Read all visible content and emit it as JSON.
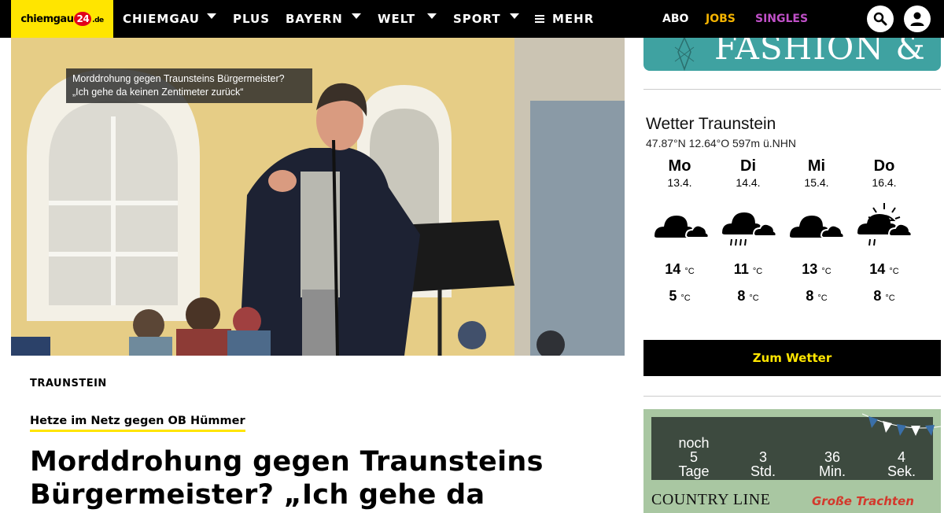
{
  "header": {
    "logo": {
      "prefix": "chiemgau",
      "number": "24",
      "suffix": ".de"
    },
    "nav": [
      {
        "label": "CHIEMGAU",
        "has_dropdown": true
      },
      {
        "label": "PLUS",
        "has_dropdown": false
      },
      {
        "label": "BAYERN",
        "has_dropdown": true
      },
      {
        "label": "WELT",
        "has_dropdown": true
      },
      {
        "label": "SPORT",
        "has_dropdown": true
      },
      {
        "label": "MEHR",
        "has_dropdown": false
      }
    ],
    "right_links": [
      {
        "label": "ABO",
        "color": "#ffffff"
      },
      {
        "label": "JOBS",
        "color": "#f5b400"
      },
      {
        "label": "SINGLES",
        "color": "#c050c8"
      }
    ],
    "search_icon": "search-icon",
    "account_icon": "user-icon"
  },
  "hero": {
    "caption_line1": "Morddrohung gegen Traunsteins Bürgermeister?",
    "caption_line2": "„Ich gehe da keinen Zentimeter zurück“"
  },
  "article": {
    "location": "TRAUNSTEIN",
    "topic": "Hetze im Netz gegen OB Hümmer",
    "headline": "Morddrohung gegen Traunsteins Bürgermeister? „Ich gehe da"
  },
  "sidebar": {
    "banner_text": "FASHION & ART",
    "weather": {
      "title": "Wetter Traunstein",
      "coords": "47.87°N 12.64°O 597m ü.NHN",
      "days": [
        {
          "name": "Mo",
          "date": "13.4.",
          "icon": "cloudy-icon",
          "max": "14",
          "min": "5",
          "unit": "°C"
        },
        {
          "name": "Di",
          "date": "14.4.",
          "icon": "rain-cloud-icon",
          "max": "11",
          "min": "8",
          "unit": "°C"
        },
        {
          "name": "Mi",
          "date": "15.4.",
          "icon": "cloudy-icon",
          "max": "13",
          "min": "8",
          "unit": "°C"
        },
        {
          "name": "Do",
          "date": "16.4.",
          "icon": "sun-cloud-rain-icon",
          "max": "14",
          "min": "8",
          "unit": "°C"
        }
      ],
      "button_label": "Zum Wetter"
    },
    "countdown": {
      "prefix": "noch",
      "units": [
        {
          "value": "5",
          "label": "Tage"
        },
        {
          "value": "3",
          "label": "Std."
        },
        {
          "value": "36",
          "label": "Min."
        },
        {
          "value": "4",
          "label": "Sek."
        }
      ],
      "footer_left": "COUNTRY LINE",
      "footer_right": "Große Trachten"
    }
  }
}
